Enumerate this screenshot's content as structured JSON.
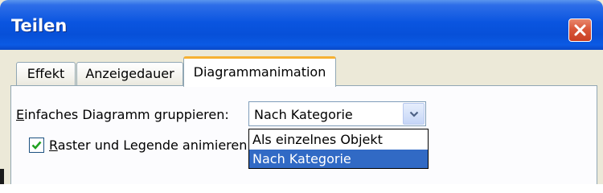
{
  "window": {
    "title": "Teilen"
  },
  "tabs": [
    {
      "label": "Effekt",
      "active": false
    },
    {
      "label": "Anzeigedauer",
      "active": false
    },
    {
      "label": "Diagrammanimation",
      "active": true
    }
  ],
  "group": {
    "label_mnemonic": "E",
    "label_rest": "infaches Diagramm gruppieren:",
    "selected": "Nach Kategorie",
    "options": [
      "Als einzelnes Objekt",
      "Nach Kategorie"
    ],
    "highlighted_option": "Nach Kategorie"
  },
  "animate": {
    "checked": true,
    "label_mnemonic": "R",
    "label_rest": "aster und Legende animieren"
  },
  "colors": {
    "titlebar": "#0a55e0",
    "selection": "#316ac5",
    "active_tab_accent": "#f6b133",
    "close_button": "#d9573a"
  },
  "icons": {
    "close": "close-icon",
    "dropdown": "chevron-down-icon",
    "check": "checkmark-icon"
  }
}
